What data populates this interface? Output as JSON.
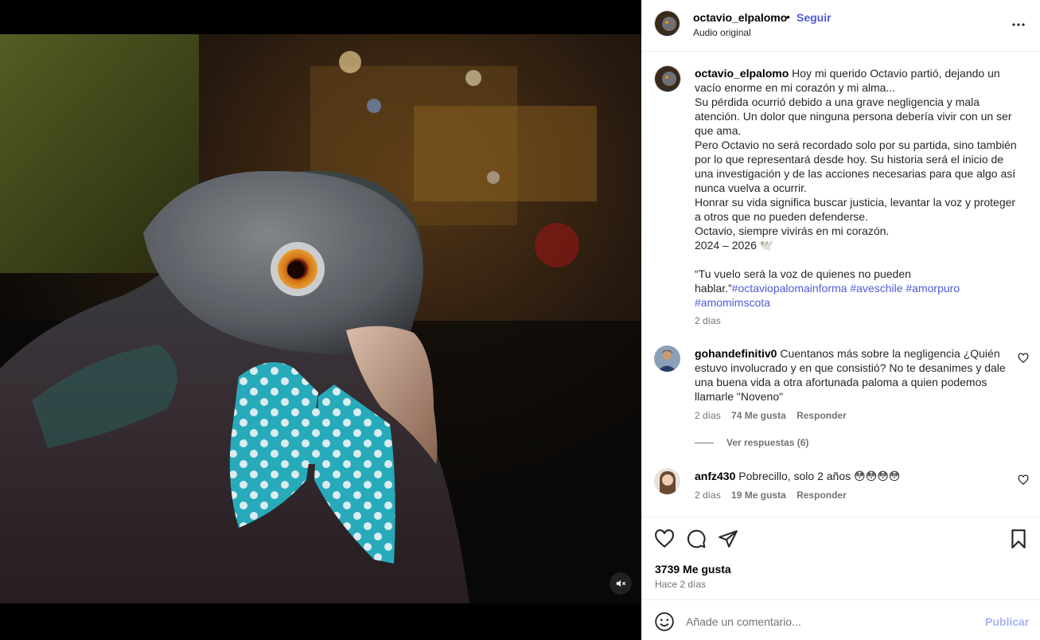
{
  "post": {
    "username": "octavio_elpalomo",
    "dot": "•",
    "follow_label": "Seguir",
    "audio": "Audio original",
    "more_label": "Más opciones"
  },
  "caption": {
    "username": "octavio_elpalomo",
    "text": "Hoy mi querido Octavio partió, dejando un vacío enorme en mi corazón y mi alma...\nSu pérdida ocurrió debido a una grave negligencia y mala atención. Un dolor que ninguna persona debería vivir con un ser que ama.\nPero Octavio no será recordado solo por su partida, sino también por lo que representará desde hoy. Su historia será el inicio de una investigación y de las acciones necesarias para que algo así nunca vuelva a ocurrir.\nHonrar su vida significa buscar justicia, levantar la voz y proteger a otros que no pueden defenderse.\nOctavio, siempre vivirás en mi corazón.\n2024 – 2026 🕊️\n\n“Tu vuelo será la voz de quienes no pueden hablar.”",
    "hashtags": [
      "#octaviopalomainforma",
      "#aveschile",
      "#amorpuro",
      "#amomimscota"
    ],
    "time": "2 días"
  },
  "comments": [
    {
      "username": "gohandefinitiv0",
      "text": "Cuentanos más sobre la negligencia ¿Quién estuvo involucrado y en que consistió? No te desanimes y dale una buena vida a otra afortunada paloma a quien podemos llamarle \"Noveno\"",
      "time": "2 días",
      "likes": "74 Me gusta",
      "reply_label": "Responder",
      "view_replies": "Ver respuestas (6)"
    },
    {
      "username": "anfz430",
      "text": "Pobrecillo, solo 2 años 😳😳😳😳",
      "time": "2 días",
      "likes": "19 Me gusta",
      "reply_label": "Responder"
    }
  ],
  "footer": {
    "likes_count": "3739 Me gusta",
    "post_time": "Hace 2 días",
    "comment_placeholder": "Añade un comentario...",
    "publish_label": "Publicar"
  },
  "icons": {
    "like": "heart-icon",
    "comment": "comment-icon",
    "share": "share-icon",
    "save": "bookmark-icon",
    "mute": "volume-off-icon",
    "emoji": "emoji-icon",
    "more": "more-icon"
  },
  "colors": {
    "link": "#4f5bd5",
    "publish_disabled": "#a6b4f7",
    "secondary_text": "#737373",
    "bowtie": "#2fb8c9"
  }
}
